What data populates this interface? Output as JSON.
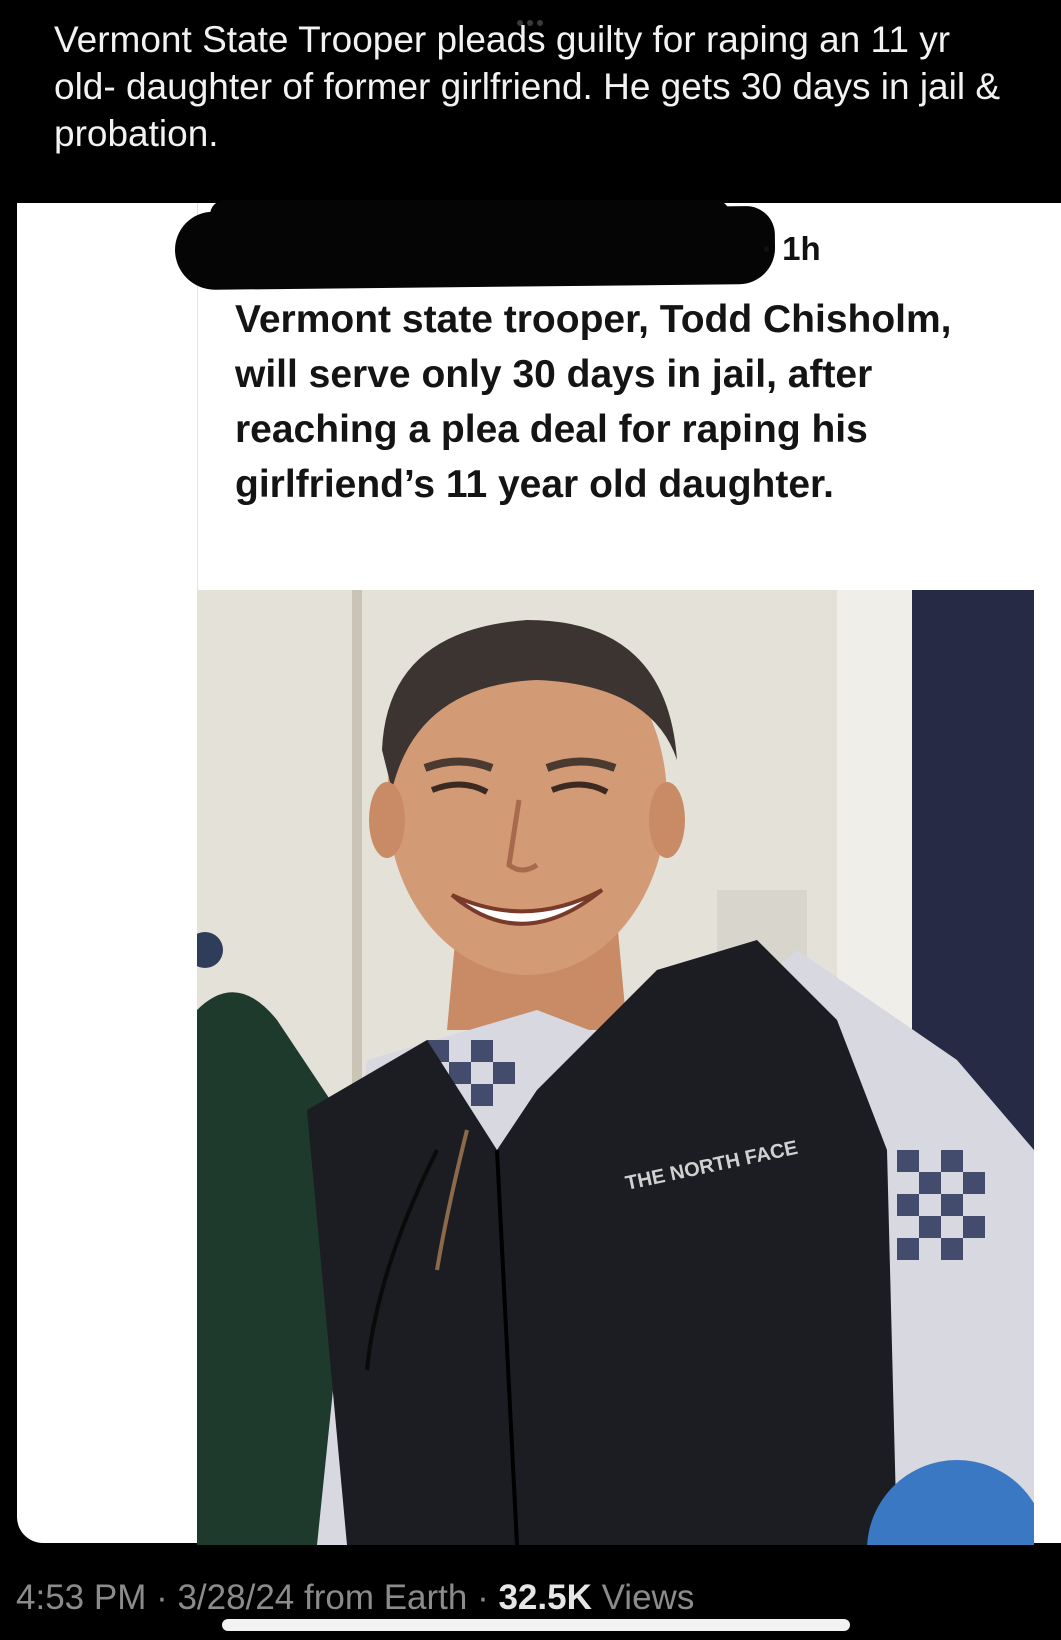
{
  "tweet": {
    "text": "Vermont State Trooper pleads guilty for raping an 11 yr old- daughter of former girlfriend. He gets 30 days in jail & probation."
  },
  "quoted_post": {
    "meta": "· 1h",
    "body": "Vermont state trooper, Todd Chisholm, will serve only 30 days in jail, after reaching a plea deal for raping his girlfriend’s 11 year old daughter.",
    "photo": {
      "vest_logo": "THE NORTH FACE"
    }
  },
  "footer": {
    "time": "4:53 PM",
    "separator": " · ",
    "date": "3/28/24",
    "source": " from Earth",
    "views_count": "32.5K",
    "views_label": " Views"
  },
  "colors": {
    "background": "#000000",
    "card": "#ffffff",
    "muted_text": "#8b8b8b"
  }
}
